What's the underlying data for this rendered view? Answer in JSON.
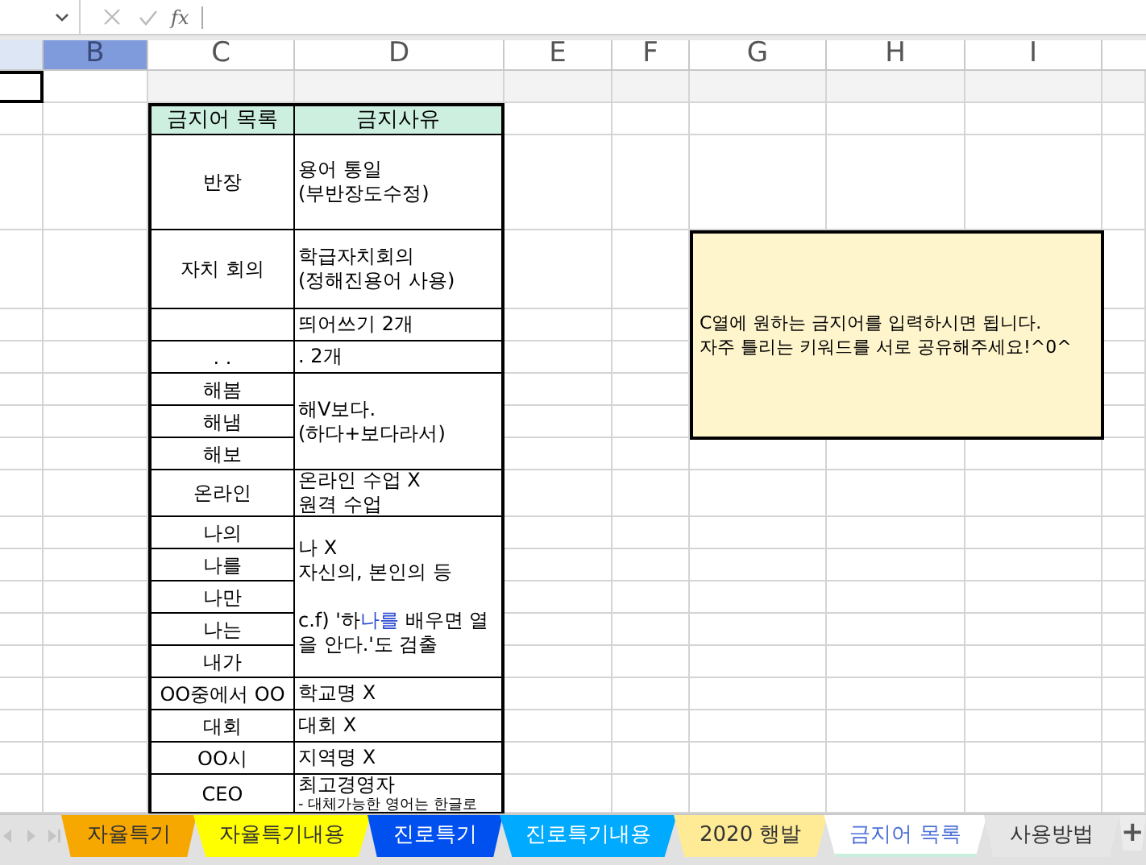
{
  "formula_bar": {
    "function_label": "fx"
  },
  "column_headers": [
    {
      "label": "B",
      "selected": true
    },
    {
      "label": "C",
      "selected": false
    },
    {
      "label": "D",
      "selected": false
    },
    {
      "label": "E",
      "selected": false
    },
    {
      "label": "F",
      "selected": false
    },
    {
      "label": "G",
      "selected": false
    },
    {
      "label": "H",
      "selected": false
    },
    {
      "label": "I",
      "selected": false
    }
  ],
  "table": {
    "header": [
      "금지어 목록",
      "금지사유"
    ],
    "groups": [
      {
        "words": [
          {
            "text": "반장"
          }
        ],
        "reason": [
          {
            "text": "용어 통일\n(부반장도수정)",
            "highlight": false
          }
        ]
      },
      {
        "words": [
          {
            "text": "자치 회의"
          }
        ],
        "reason": [
          {
            "text": "학급자치회의\n(정해진용어 사용)",
            "highlight": false
          }
        ]
      },
      {
        "words": [
          {
            "kind": "blank"
          }
        ],
        "reason": [
          {
            "text": "띄어쓰기 2개",
            "highlight": false
          }
        ]
      },
      {
        "words": [
          {
            "text": ". ."
          }
        ],
        "reason": [
          {
            "text": ". 2개",
            "highlight": false
          }
        ]
      },
      {
        "words": [
          {
            "text": "해봄"
          },
          {
            "text": "해냄"
          },
          {
            "text": "해보"
          }
        ],
        "reason": [
          {
            "text": "해V보다.\n(하다+보다라서)",
            "highlight": false
          }
        ]
      },
      {
        "words": [
          {
            "text": "온라인"
          }
        ],
        "reason": [
          {
            "text": "온라인 수업 X\n원격 수업",
            "highlight": false
          }
        ]
      },
      {
        "words": [
          {
            "text": "나의"
          },
          {
            "text": "나를"
          },
          {
            "text": "나만"
          },
          {
            "text": "나는"
          },
          {
            "text": "내가"
          }
        ],
        "reason": [
          {
            "text": "나 X\n자신의, 본인의 등\n\nc.f) '하",
            "highlight": false
          },
          {
            "text": "나를",
            "highlight": true
          },
          {
            "text": " 배우면 열을 안다.'도 검출",
            "highlight": false
          }
        ]
      },
      {
        "words": [
          {
            "text": "OO중에서 OO"
          }
        ],
        "reason": [
          {
            "text": "학교명 X",
            "highlight": false
          }
        ]
      },
      {
        "words": [
          {
            "text": "대회"
          }
        ],
        "reason": [
          {
            "text": "대회 X",
            "highlight": false
          }
        ]
      },
      {
        "words": [
          {
            "text": "OO시"
          }
        ],
        "reason": [
          {
            "text": "지역명 X",
            "highlight": false
          }
        ]
      },
      {
        "words": [
          {
            "text": "CEO"
          }
        ],
        "reason": [
          {
            "text": "최고경영자",
            "highlight": false
          }
        ],
        "note": "- 대체가능한 영어는 한글로"
      }
    ]
  },
  "note_box": {
    "lines": [
      "C열에 원하는 금지어를 입력하시면 됩니다.",
      "자주 틀리는 키워드를 서로 공유해주세요!^0^"
    ]
  },
  "sheet_tabs": [
    {
      "label": "자율특기",
      "color": "#f7a800",
      "selected": false
    },
    {
      "label": "자율특기내용",
      "color": "#ffff00",
      "selected": false
    },
    {
      "label": "진로특기",
      "color": "#0050f0",
      "selected": false
    },
    {
      "label": "진로특기내용",
      "color": "#00aaff",
      "selected": false
    },
    {
      "label": "2020 행발",
      "color": "#ffeb95",
      "selected": false
    },
    {
      "label": "금지어 목록",
      "color": "#c8eedd",
      "selected": true
    },
    {
      "label": "사용방법",
      "color": "#e6e6e6",
      "selected": false
    }
  ],
  "add_sheet_label": "+"
}
